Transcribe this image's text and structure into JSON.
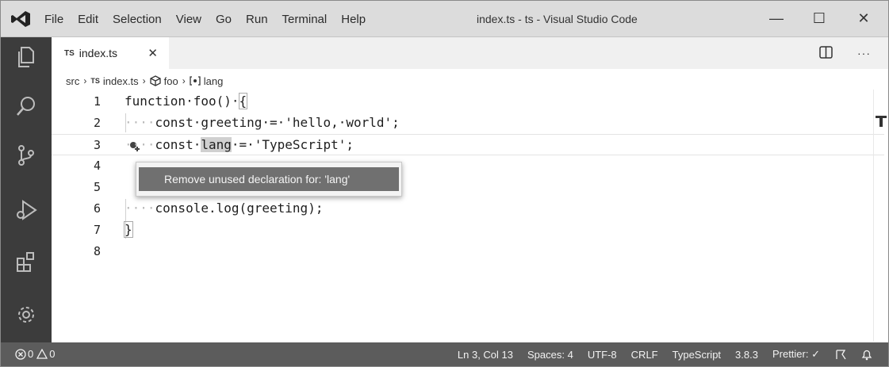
{
  "window": {
    "title": "index.ts - ts - Visual Studio Code"
  },
  "menu": [
    "File",
    "Edit",
    "Selection",
    "View",
    "Go",
    "Run",
    "Terminal",
    "Help"
  ],
  "controls": {
    "minimize": "—",
    "maximize": "☐",
    "close": "✕"
  },
  "tab": {
    "badge": "TS",
    "label": "index.ts",
    "close": "✕"
  },
  "tabbar": {
    "more": "···"
  },
  "breadcrumb": {
    "folder": "src",
    "file_badge": "TS",
    "file": "index.ts",
    "function": "foo",
    "variable": "lang",
    "separator": "›"
  },
  "editor": {
    "lines": [
      {
        "num": "1"
      },
      {
        "num": "2"
      },
      {
        "num": "3"
      },
      {
        "num": "4"
      },
      {
        "num": "5"
      },
      {
        "num": "6"
      },
      {
        "num": "7"
      },
      {
        "num": "8"
      }
    ],
    "code": {
      "l1_a": "function·foo()·",
      "l1_brace": "{",
      "l2_ws": "····",
      "l2_code": "const·greeting·=·'hello,·world';",
      "l3_ws": "····",
      "l3_a": "const·",
      "l3_sel": "lang",
      "l3_b": "·=·'TypeScript';",
      "l6_ws": "····",
      "l6_code": "console.log(greeting);",
      "l7_brace": "}"
    }
  },
  "quickfix": {
    "label": "Remove unused declaration for: 'lang'"
  },
  "status": {
    "errors": "0",
    "warnings": "0",
    "position": "Ln 3, Col 13",
    "spaces": "Spaces: 4",
    "encoding": "UTF-8",
    "eol": "CRLF",
    "language": "TypeScript",
    "version": "3.8.3",
    "prettier": "Prettier: ✓"
  }
}
